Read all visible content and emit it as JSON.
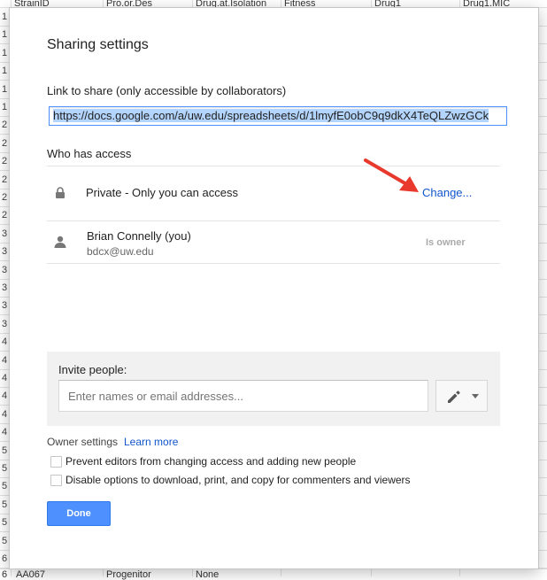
{
  "spreadsheet": {
    "headers": [
      "StrainID",
      "Pro.or.Des",
      "Drug.at.Isolation",
      "Fitness",
      "Drug1",
      "Drug1.MIC"
    ],
    "row_numbers": [
      "1",
      "1",
      "1",
      "1",
      "1",
      "1",
      "2",
      "2",
      "2",
      "2",
      "2",
      "2",
      "3",
      "3",
      "3",
      "3",
      "3",
      "3",
      "4",
      "4",
      "4",
      "4",
      "4",
      "4",
      "5",
      "5",
      "5",
      "5",
      "5",
      "5",
      "6"
    ],
    "bottom_row": [
      "6",
      "AA067",
      "Progenitor",
      "None"
    ]
  },
  "dialog": {
    "title": "Sharing settings",
    "link_label": "Link to share (only accessible by collaborators)",
    "link_value": "https://docs.google.com/a/uw.edu/spreadsheets/d/1lmyfE0obC9q9dkX4TeQLZwzGCk",
    "who_has_access_label": "Who has access",
    "access": {
      "icon": "lock-icon",
      "text": "Private - Only you can access",
      "change_link": "Change..."
    },
    "user": {
      "icon": "person-icon",
      "name": "Brian Connelly (you)",
      "email": "bdcx@uw.edu",
      "role": "Is owner"
    },
    "invite": {
      "label": "Invite people:",
      "placeholder": "Enter names or email addresses...",
      "permission_icon": "pencil-icon"
    },
    "owner_settings": {
      "label": "Owner settings",
      "learn_more": "Learn more",
      "options": [
        {
          "label": "Prevent editors from changing access and adding new people",
          "checked": false
        },
        {
          "label": "Disable options to download, print, and copy for commenters and viewers",
          "checked": false
        }
      ]
    },
    "done_label": "Done"
  },
  "colors": {
    "accent_blue": "#4d90fe",
    "link_blue": "#1155cc",
    "annotation_arrow": "#e8392c"
  }
}
